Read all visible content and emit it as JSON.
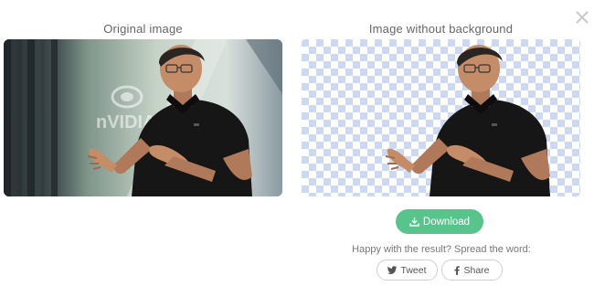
{
  "dialog": {
    "close_icon": "close-icon",
    "original_title": "Original image",
    "result_title": "Image without background",
    "watermark_text": "nVIDIA"
  },
  "actions": {
    "download_label": "Download",
    "download_icon": "download-icon",
    "share_prompt": "Happy with the result? Spread the word:",
    "tweet_label": "Tweet",
    "tweet_icon": "twitter-icon",
    "share_label": "Share",
    "share_icon": "facebook-icon"
  },
  "colors": {
    "accent_green": "#56c48b",
    "checker_blue": "#cdd9f0",
    "shirt": "#161616"
  }
}
